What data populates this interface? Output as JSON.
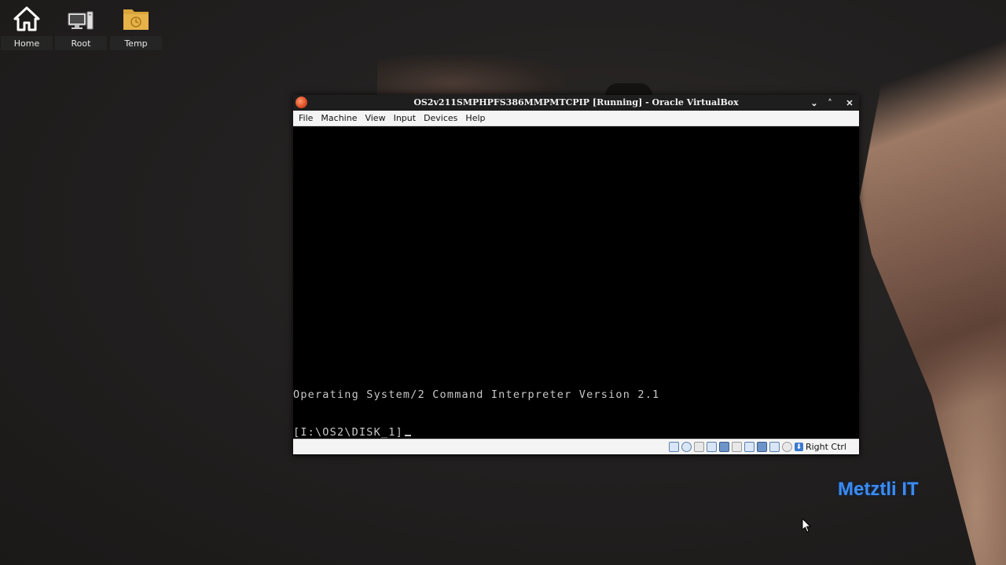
{
  "desktop": {
    "icons": [
      {
        "label": "Home",
        "icon": "home-icon"
      },
      {
        "label": "Root",
        "icon": "computer-icon"
      },
      {
        "label": "Temp",
        "icon": "folder-clock-icon"
      }
    ],
    "watermark": "Metztli IT"
  },
  "window": {
    "title": "OS2v211SMPHPFS386MMPMTCPIP [Running] - Oracle VirtualBox",
    "controls": {
      "minimize": "⌄",
      "maximize": "˄",
      "close": "✕"
    },
    "menu": [
      "File",
      "Machine",
      "View",
      "Input",
      "Devices",
      "Help"
    ],
    "console": {
      "banner": "Operating System/2 Command Interpreter Version 2.1",
      "prompt": "[I:\\OS2\\DISK_1]"
    },
    "status": {
      "indicators": [
        "hard-disk-icon",
        "optical-disk-icon",
        "audio-icon",
        "network-icon",
        "usb-icon",
        "shared-folders-icon",
        "display-icon",
        "video-capture-icon",
        "cpu-icon",
        "mouse-integration-icon"
      ],
      "host_key": "Right Ctrl"
    }
  },
  "colors": {
    "watermark": "#3c8cf0",
    "titlebar": "#1e1e1e",
    "console_bg": "#000000",
    "console_text": "#c8c8c8"
  }
}
